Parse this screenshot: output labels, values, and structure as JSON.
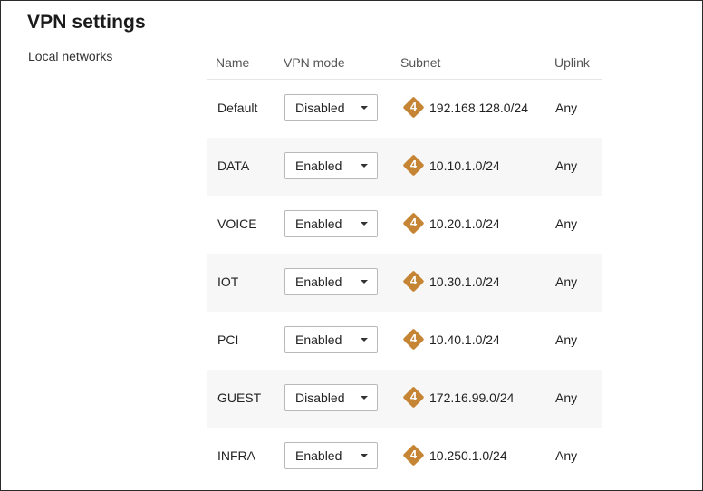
{
  "page": {
    "title": "VPN settings",
    "section_label": "Local networks"
  },
  "table": {
    "headers": {
      "name": "Name",
      "vpn_mode": "VPN mode",
      "subnet": "Subnet",
      "uplink": "Uplink"
    },
    "rows": [
      {
        "name": "Default",
        "vpn_mode": "Disabled",
        "ip_version": "4",
        "subnet": "192.168.128.0/24",
        "uplink": "Any"
      },
      {
        "name": "DATA",
        "vpn_mode": "Enabled",
        "ip_version": "4",
        "subnet": "10.10.1.0/24",
        "uplink": "Any"
      },
      {
        "name": "VOICE",
        "vpn_mode": "Enabled",
        "ip_version": "4",
        "subnet": "10.20.1.0/24",
        "uplink": "Any"
      },
      {
        "name": "IOT",
        "vpn_mode": "Enabled",
        "ip_version": "4",
        "subnet": "10.30.1.0/24",
        "uplink": "Any"
      },
      {
        "name": "PCI",
        "vpn_mode": "Enabled",
        "ip_version": "4",
        "subnet": "10.40.1.0/24",
        "uplink": "Any"
      },
      {
        "name": "GUEST",
        "vpn_mode": "Disabled",
        "ip_version": "4",
        "subnet": "172.16.99.0/24",
        "uplink": "Any"
      },
      {
        "name": "INFRA",
        "vpn_mode": "Enabled",
        "ip_version": "4",
        "subnet": "10.250.1.0/24",
        "uplink": "Any"
      }
    ]
  },
  "icons": {
    "ipv4_badge": "ipv4-diamond-icon",
    "dropdown": "chevron-down-icon"
  },
  "colors": {
    "ipv4_badge": "#c58534",
    "alt_row_background": "#f7f7f7"
  }
}
